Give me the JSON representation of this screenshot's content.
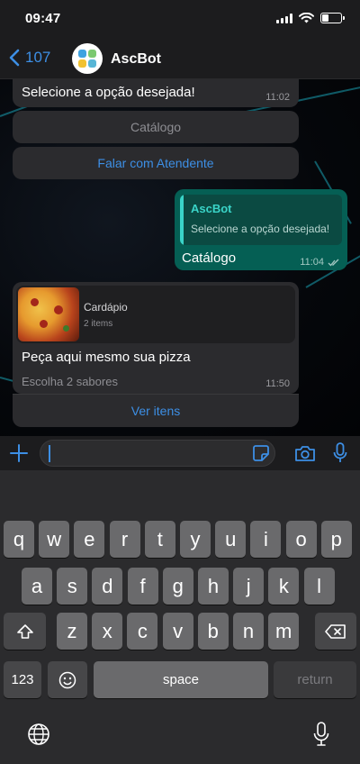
{
  "status_bar": {
    "time": "09:47"
  },
  "header": {
    "back_count": "107",
    "title": "AscBot"
  },
  "messages": {
    "menu_text": "Selecione a opção desejada!",
    "menu_time": "11:02",
    "option_catalog": "Catálogo",
    "option_agent": "Falar com Atendente",
    "reply_quote_author": "AscBot",
    "reply_quote_text": "Selecione a opção desejada!",
    "reply_text": "Catálogo",
    "reply_time": "11:04",
    "catalog_title": "Cardápio",
    "catalog_count": "2 items",
    "catalog_text": "Peça aqui mesmo sua pizza",
    "catalog_footer": "Escolha 2 sabores",
    "catalog_time": "11:50",
    "catalog_button": "Ver itens"
  },
  "keyboard": {
    "row1": [
      "q",
      "w",
      "e",
      "r",
      "t",
      "y",
      "u",
      "i",
      "o",
      "p"
    ],
    "row2": [
      "a",
      "s",
      "d",
      "f",
      "g",
      "h",
      "j",
      "k",
      "l"
    ],
    "row3": [
      "z",
      "x",
      "c",
      "v",
      "b",
      "n",
      "m"
    ],
    "numbers_key": "123",
    "space_key": "space",
    "return_key": "return"
  },
  "colors": {
    "accent": "#3d8fe5",
    "outgoing_bubble": "#055f54",
    "incoming_bubble": "#2b2b2e",
    "quote_bar": "#3ad4c8"
  }
}
